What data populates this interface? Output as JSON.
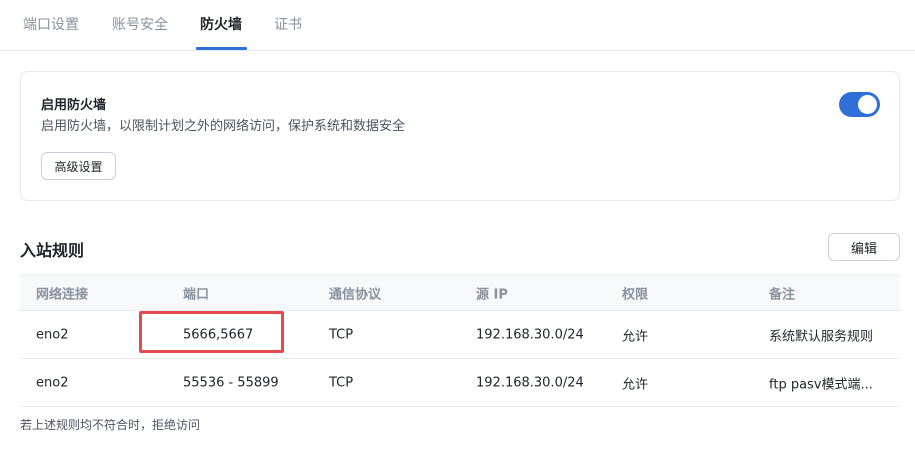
{
  "tabs": [
    {
      "label": "端口设置",
      "active": false
    },
    {
      "label": "账号安全",
      "active": false
    },
    {
      "label": "防火墙",
      "active": true
    },
    {
      "label": "证书",
      "active": false
    }
  ],
  "firewall_card": {
    "title": "启用防火墙",
    "description": "启用防火墙，以限制计划之外的网络访问，保护系统和数据安全",
    "toggle_on": true,
    "advanced_button": "高级设置"
  },
  "inbound": {
    "title": "入站规则",
    "edit_button": "编辑",
    "columns": [
      "网络连接",
      "端口",
      "通信协议",
      "源 IP",
      "权限",
      "备注"
    ],
    "rows": [
      [
        "eno2",
        "5666,5667",
        "TCP",
        "192.168.30.0/24",
        "允许",
        "系统默认服务规则"
      ],
      [
        "eno2",
        "55536 - 55899",
        "TCP",
        "192.168.30.0/24",
        "允许",
        "ftp pasv模式端..."
      ]
    ],
    "footer": "若上述规则均不符合时，拒绝访问"
  },
  "colors": {
    "accent": "#2f6fd8",
    "highlight": "#e5484d"
  }
}
